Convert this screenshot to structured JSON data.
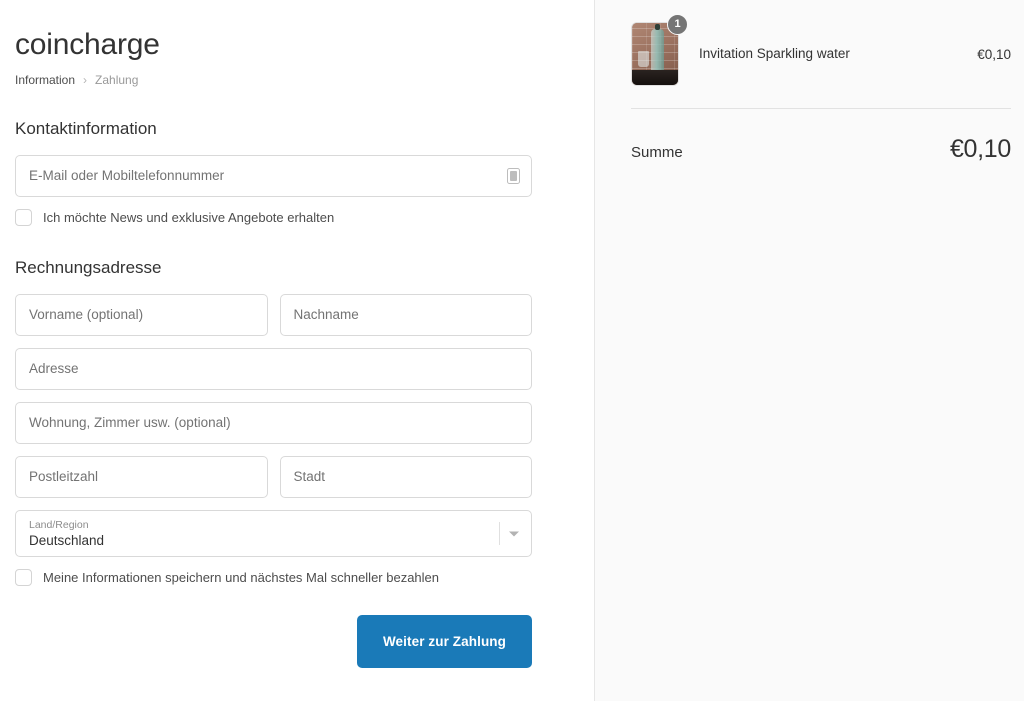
{
  "store": {
    "name": "coincharge"
  },
  "breadcrumb": {
    "step_previous": "Information",
    "separator": "›",
    "step_current": "Zahlung"
  },
  "contact": {
    "section_title": "Kontaktinformation",
    "email_placeholder": "E-Mail oder Mobiltelefonnummer",
    "email_value": "",
    "email_icon": "mobile-contact-icon",
    "newsletter_label": "Ich möchte News und exklusive Angebote erhalten",
    "newsletter_checked": false
  },
  "billing": {
    "section_title": "Rechnungsadresse",
    "first_name_placeholder": "Vorname (optional)",
    "first_name_value": "",
    "last_name_placeholder": "Nachname",
    "last_name_value": "",
    "address_placeholder": "Adresse",
    "address_value": "",
    "address2_placeholder": "Wohnung, Zimmer usw. (optional)",
    "address2_value": "",
    "postal_code_placeholder": "Postleitzahl",
    "postal_code_value": "",
    "city_placeholder": "Stadt",
    "city_value": "",
    "country_label": "Land/Region",
    "country_value": "Deutschland",
    "country_caret_icon": "chevron-down-icon",
    "save_info_label": "Meine Informationen speichern und nächstes Mal schneller bezahlen",
    "save_info_checked": false
  },
  "actions": {
    "continue_label": "Weiter zur Zahlung",
    "continue_color": "#1a7ab8"
  },
  "summary": {
    "items": [
      {
        "name": "Invitation Sparkling water",
        "quantity": "1",
        "price": "€0,10",
        "thumbnail": "sparkling-water-bottle-photo"
      }
    ],
    "total_label": "Summe",
    "total_value": "€0,10"
  }
}
